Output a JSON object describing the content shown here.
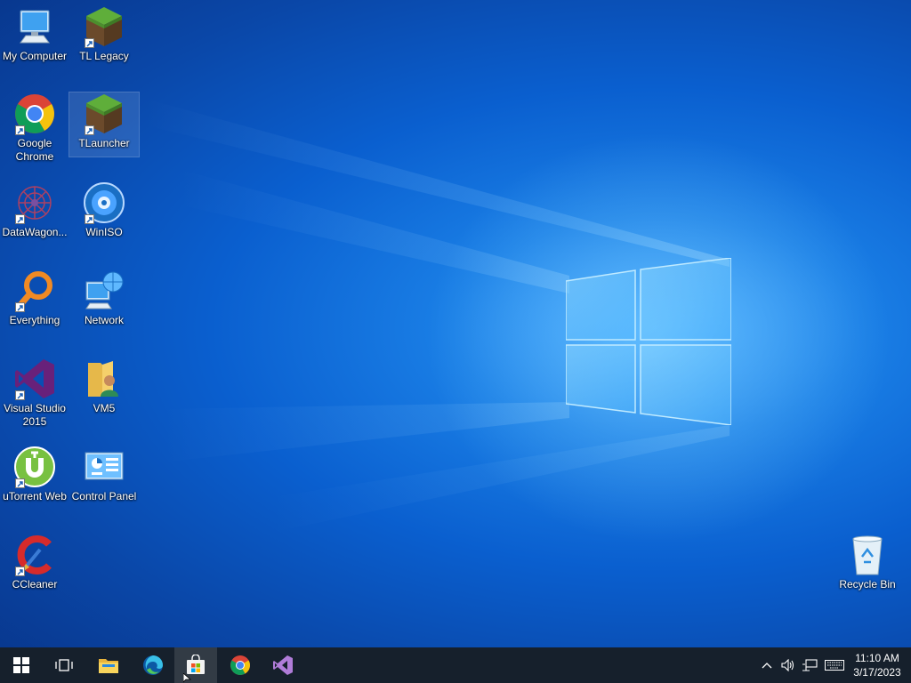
{
  "desktop": {
    "icons": [
      {
        "id": "my-computer",
        "label": "My Computer"
      },
      {
        "id": "tl-legacy",
        "label": "TL Legacy"
      },
      {
        "id": "google-chrome",
        "label": "Google Chrome"
      },
      {
        "id": "tlauncher",
        "label": "TLauncher"
      },
      {
        "id": "datawagon",
        "label": "DataWagon..."
      },
      {
        "id": "winiso",
        "label": "WinISO"
      },
      {
        "id": "everything",
        "label": "Everything"
      },
      {
        "id": "network",
        "label": "Network"
      },
      {
        "id": "visual-studio",
        "label": "Visual Studio 2015"
      },
      {
        "id": "vm5",
        "label": "VM5"
      },
      {
        "id": "utorrent",
        "label": "uTorrent Web"
      },
      {
        "id": "control-panel",
        "label": "Control Panel"
      },
      {
        "id": "ccleaner",
        "label": "CCleaner"
      },
      {
        "id": "recycle-bin",
        "label": "Recycle Bin"
      }
    ]
  },
  "taskbar": {
    "buttons": [
      {
        "id": "start",
        "icon": "windows-logo-icon"
      },
      {
        "id": "task-view",
        "icon": "task-view-icon"
      },
      {
        "id": "file-explorer",
        "icon": "folder-icon"
      },
      {
        "id": "edge",
        "icon": "edge-icon"
      },
      {
        "id": "store",
        "icon": "store-icon"
      },
      {
        "id": "chrome",
        "icon": "chrome-icon"
      },
      {
        "id": "visual-studio",
        "icon": "visual-studio-icon"
      }
    ],
    "tray": {
      "icons": [
        "chevron-up-icon",
        "speaker-icon",
        "network-icon",
        "keyboard-icon"
      ],
      "time": "11:10 AM",
      "date": "3/17/2023"
    }
  },
  "colors": {
    "taskbar": "#16202c",
    "accent": "#76b9ed",
    "wallpaper": "#0a5fcf"
  }
}
